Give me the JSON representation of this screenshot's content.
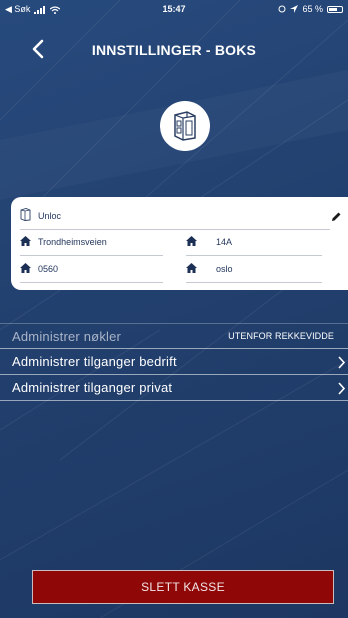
{
  "status_bar": {
    "back_app": "◀ Søk",
    "time": "15:47",
    "battery_percent_text": "65 %",
    "battery_level": 0.65
  },
  "header": {
    "title": "INNSTILLINGER - BOKS",
    "back_icon": "chevron-left-icon"
  },
  "box": {
    "name": "Unloc",
    "street": "Trondheimsveien",
    "number": "14A",
    "postal_code": "0560",
    "city": "oslo"
  },
  "menu": {
    "items": [
      {
        "label": "Administrer nøkler",
        "status": "UTENFOR REKKEVIDDE",
        "enabled": false
      },
      {
        "label": "Administrer tilganger bedrift",
        "enabled": true
      },
      {
        "label": "Administrer tilganger privat",
        "enabled": true
      }
    ]
  },
  "actions": {
    "delete_label": "SLETT KASSE"
  },
  "colors": {
    "background": "#22406e",
    "delete_button": "#8f0707",
    "card_text": "#24375c"
  }
}
